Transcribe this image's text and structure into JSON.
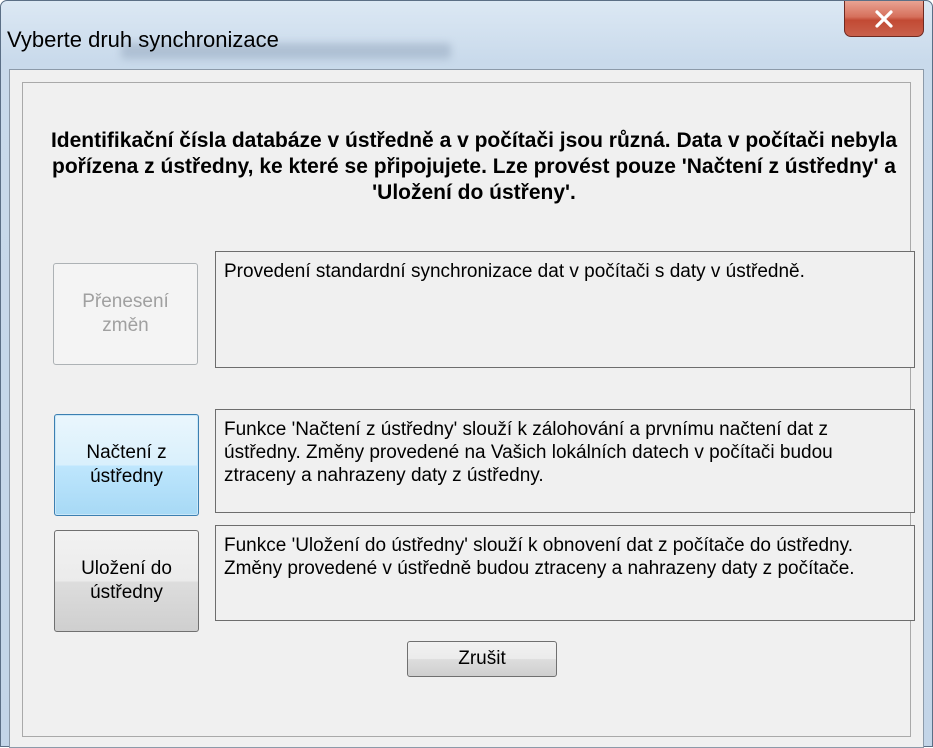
{
  "window": {
    "title": "Vyberte druh synchronizace"
  },
  "message": "Identifikační čísla databáze v ústředně a v počítači jsou různá. Data v počítači nebyla pořízena z ústředny, ke které se připojujete. Lze provést pouze 'Načtení z ústředny' a 'Uložení do ústřeny'.",
  "options": [
    {
      "button_label": "Přenesení změn",
      "description": "Provedení standardní synchronizace dat v počítači s daty v ústředně.",
      "enabled": false
    },
    {
      "button_label": "Načtení z ústředny",
      "description": "Funkce 'Načtení z ústředny' slouží k zálohování a prvnímu načtení dat z ústředny. Změny provedené na Vašich lokálních datech v počítači budou ztraceny a nahrazeny daty z ústředny.",
      "enabled": true
    },
    {
      "button_label": "Uložení do ústředny",
      "description": "Funkce 'Uložení do ústředny' slouží k obnovení dat z počítače do ústředny. Změny provedené v ústředně budou ztraceny a nahrazeny daty z počítače.",
      "enabled": true
    }
  ],
  "cancel_label": "Zrušit",
  "icons": {
    "close": "close-icon"
  },
  "colors": {
    "close_button": "#c9604b",
    "focus_border": "#3c7fb1",
    "disabled_text": "#a0a0a0"
  }
}
